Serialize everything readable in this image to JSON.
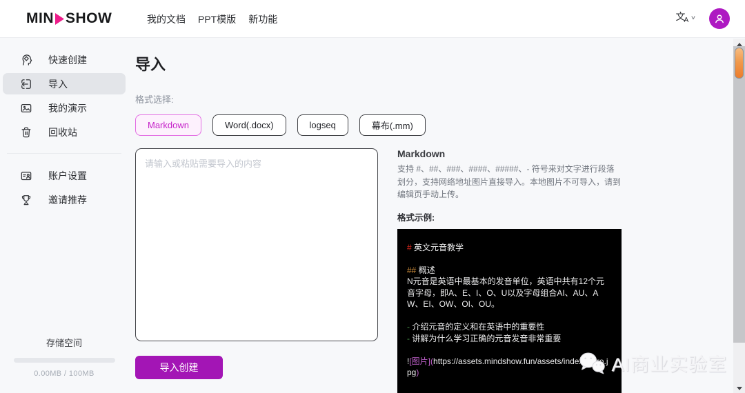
{
  "header": {
    "logo_part1": "MIN",
    "logo_part2": "SHOW",
    "nav": [
      {
        "label": "我的文档"
      },
      {
        "label": "PPT模版"
      },
      {
        "label": "新功能"
      }
    ]
  },
  "icons": {
    "translate_main": "文",
    "translate_sub": "A",
    "chevron_down": "∨"
  },
  "sidebar": {
    "items": [
      {
        "label": "快速创建",
        "icon": "brain-head-icon",
        "selected": false
      },
      {
        "label": "导入",
        "icon": "import-icon",
        "selected": true
      },
      {
        "label": "我的演示",
        "icon": "presentation-icon",
        "selected": false
      },
      {
        "label": "回收站",
        "icon": "trash-icon",
        "selected": false
      }
    ],
    "secondary_items": [
      {
        "label": "账户设置",
        "icon": "id-card-icon"
      },
      {
        "label": "邀请推荐",
        "icon": "trophy-icon"
      }
    ],
    "storage": {
      "title": "存储空间",
      "usage": "0.00MB / 100MB",
      "used_percent": 0
    }
  },
  "main": {
    "title": "导入",
    "format_label": "格式选择:",
    "format_options": [
      {
        "label": "Markdown",
        "selected": true
      },
      {
        "label": "Word(.docx)",
        "selected": false
      },
      {
        "label": "logseq",
        "selected": false
      },
      {
        "label": "幕布(.mm)",
        "selected": false
      }
    ],
    "textarea_placeholder": "请输入或粘贴需要导入的内容",
    "textarea_value": "",
    "import_button_label": "导入创建"
  },
  "help": {
    "title": "Markdown",
    "description": "支持 #、##、###、####、#####、- 符号来对文字进行段落划分，支持网络地址图片直接导入。本地图片不可导入，请到编辑页手动上传。",
    "example_label": "格式示例:",
    "example": {
      "h1_prefix": "#",
      "h1_text": " 英文元音教学",
      "h2_prefix": "##",
      "h2_text": " 概述",
      "paragraph": " N元音是英语中最基本的发音单位，英语中共有12个元音字母，即A、E、I、O、U以及字母组合AI、AU、AW、EI、OW、OI、OU。",
      "bullet1_prefix": "-",
      "bullet1_text": " 介绍元音的定义和在英语中的重要性",
      "bullet2_prefix": "-",
      "bullet2_text": " 讲解为什么学习正确的元音发音非常重要",
      "image_bang": "!",
      "image_open": "[图片](",
      "image_url": "https://assets.mindshow.fun/assets/index_intro.jpg",
      "image_close": ")"
    }
  },
  "watermark": {
    "text": "AI商业实验室"
  },
  "colors": {
    "brand_pink": "#ee1d8b",
    "primary_purple": "#a315b5",
    "avatar_purple": "#ae19c2",
    "format_selected_text": "#c521c9",
    "format_selected_border": "#e36ee3",
    "format_selected_bg": "#fdf1fd",
    "sidebar_selected_bg": "#e3e5e9",
    "code_block_bg": "#000000",
    "scrollbar_thumb_orange": "#ed7c2b"
  }
}
